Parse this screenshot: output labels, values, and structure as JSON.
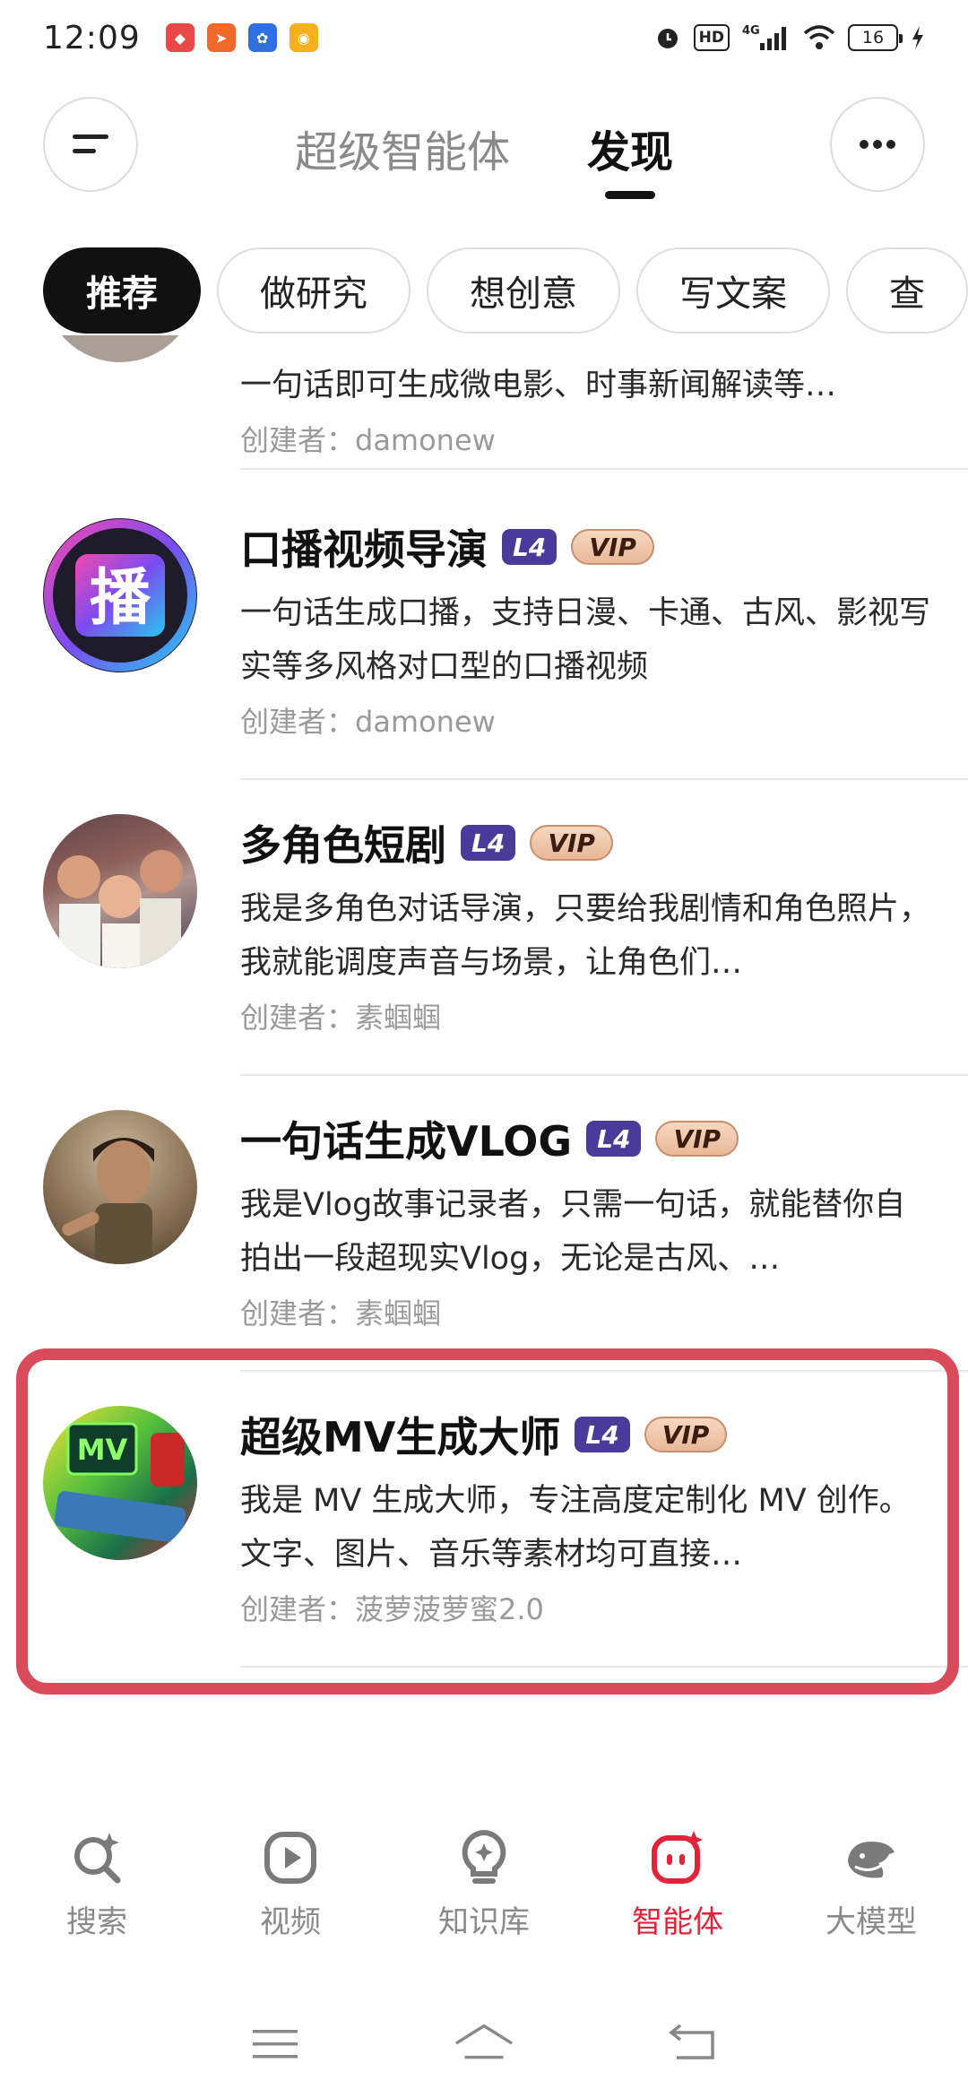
{
  "status_bar": {
    "time": "12:09",
    "network": "4G",
    "hd": "HD",
    "battery": "16"
  },
  "header": {
    "tabs": [
      {
        "label": "超级智能体",
        "active": false
      },
      {
        "label": "发现",
        "active": true
      }
    ]
  },
  "chips": [
    {
      "label": "推荐",
      "active": true
    },
    {
      "label": "做研究",
      "active": false
    },
    {
      "label": "想创意",
      "active": false
    },
    {
      "label": "写文案",
      "active": false
    },
    {
      "label": "查",
      "active": false
    }
  ],
  "partial_item": {
    "desc": "一句话即可生成微电影、时事新闻解读等…",
    "creator": "创建者：damonew"
  },
  "items": [
    {
      "title": "口播视频导演",
      "badges": [
        "L4",
        "VIP"
      ],
      "desc": "一句话生成口播，支持日漫、卡通、古风、影视写实等多风格对口型的口播视频",
      "creator": "创建者：damonew",
      "avatar_text": "播"
    },
    {
      "title": "多角色短剧",
      "badges": [
        "L4",
        "VIP"
      ],
      "desc": "我是多角色对话导演，只要给我剧情和角色照片，我就能调度声音与场景，让角色们…",
      "creator": "创建者：素蝈蝈"
    },
    {
      "title": "一句话生成VLOG",
      "badges": [
        "L4",
        "VIP"
      ],
      "desc": "我是Vlog故事记录者，只需一句话，就能替你自拍出一段超现实Vlog，无论是古风、…",
      "creator": "创建者：素蝈蝈"
    },
    {
      "title": "超级MV生成大师",
      "badges": [
        "L4",
        "VIP"
      ],
      "desc": "我是 MV 生成大师，专注高度定制化 MV 创作。文字、图片、音乐等素材均可直接…",
      "creator": "创建者：菠萝菠萝蜜2.0",
      "avatar_text": "MV",
      "highlighted": true
    }
  ],
  "bottom_nav": [
    {
      "label": "搜索",
      "icon": "search-sparkle-icon",
      "active": false
    },
    {
      "label": "视频",
      "icon": "play-icon",
      "active": false
    },
    {
      "label": "知识库",
      "icon": "lightbulb-icon",
      "active": false
    },
    {
      "label": "智能体",
      "icon": "agent-icon",
      "active": true
    },
    {
      "label": "大模型",
      "icon": "whale-icon",
      "active": false
    }
  ],
  "colors": {
    "accent": "#e2233a",
    "highlight_border": "#d94a5a",
    "l4_badge": "#4a3a9a"
  }
}
